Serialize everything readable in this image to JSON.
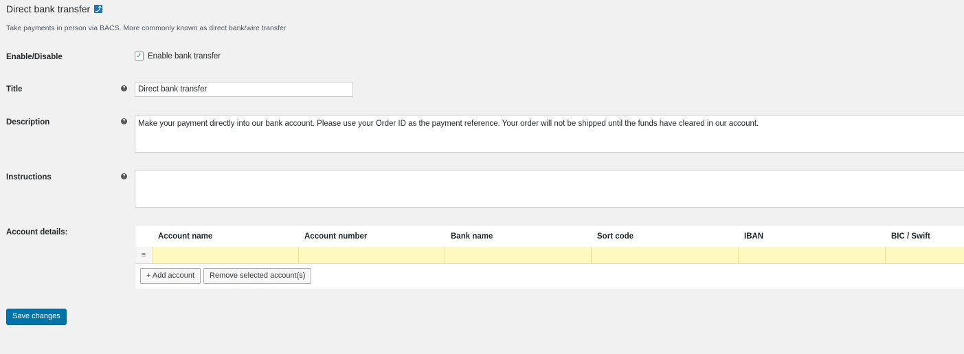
{
  "page": {
    "title": "Direct bank transfer",
    "back_icon": "⤴",
    "subtitle": "Take payments in person via BACS. More commonly known as direct bank/wire transfer"
  },
  "fields": {
    "enable": {
      "label": "Enable/Disable",
      "checkbox_label": "Enable bank transfer",
      "checked": true
    },
    "title": {
      "label": "Title",
      "value": "Direct bank transfer"
    },
    "description": {
      "label": "Description",
      "value": "Make your payment directly into our bank account. Please use your Order ID as the payment reference. Your order will not be shipped until the funds have cleared in our account."
    },
    "instructions": {
      "label": "Instructions",
      "value": ""
    },
    "accounts": {
      "label": "Account details:"
    }
  },
  "accounts_table": {
    "columns": [
      "Account name",
      "Account number",
      "Bank name",
      "Sort code",
      "IBAN",
      "BIC / Swift"
    ],
    "add_label": "+ Add account",
    "remove_label": "Remove selected account(s)"
  },
  "save_label": "Save changes",
  "help_glyph": "?",
  "drag_glyph": "≡",
  "check_glyph": "✓",
  "colors": {
    "accent": "#0073aa",
    "row_highlight": "#fff9c0"
  }
}
